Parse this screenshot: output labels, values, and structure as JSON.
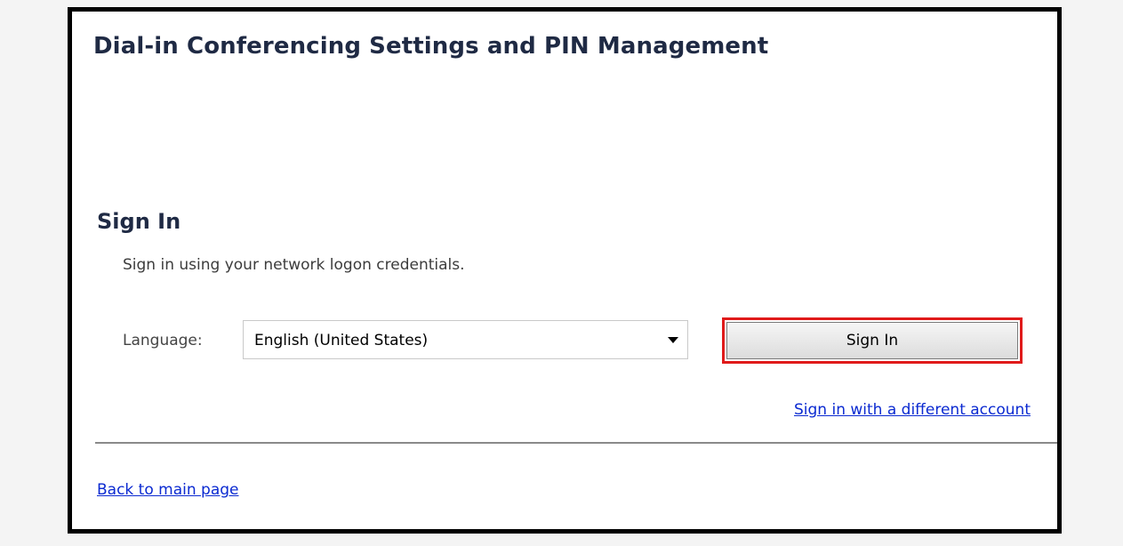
{
  "header": {
    "title": "Dial-in Conferencing Settings and PIN Management"
  },
  "signin": {
    "title": "Sign In",
    "subtitle": "Sign in using your network logon credentials.",
    "language_label": "Language:",
    "language_value": "English (United States)",
    "button_label": "Sign In",
    "different_account_link": "Sign in with a different account"
  },
  "footer": {
    "back_link": "Back to main page"
  },
  "colors": {
    "title_text": "#1f2a44",
    "link": "#0b2ad1",
    "highlight_border": "#e01a1a",
    "frame_border": "#000000"
  },
  "icons": {
    "dropdown": "chevron-down-icon"
  }
}
